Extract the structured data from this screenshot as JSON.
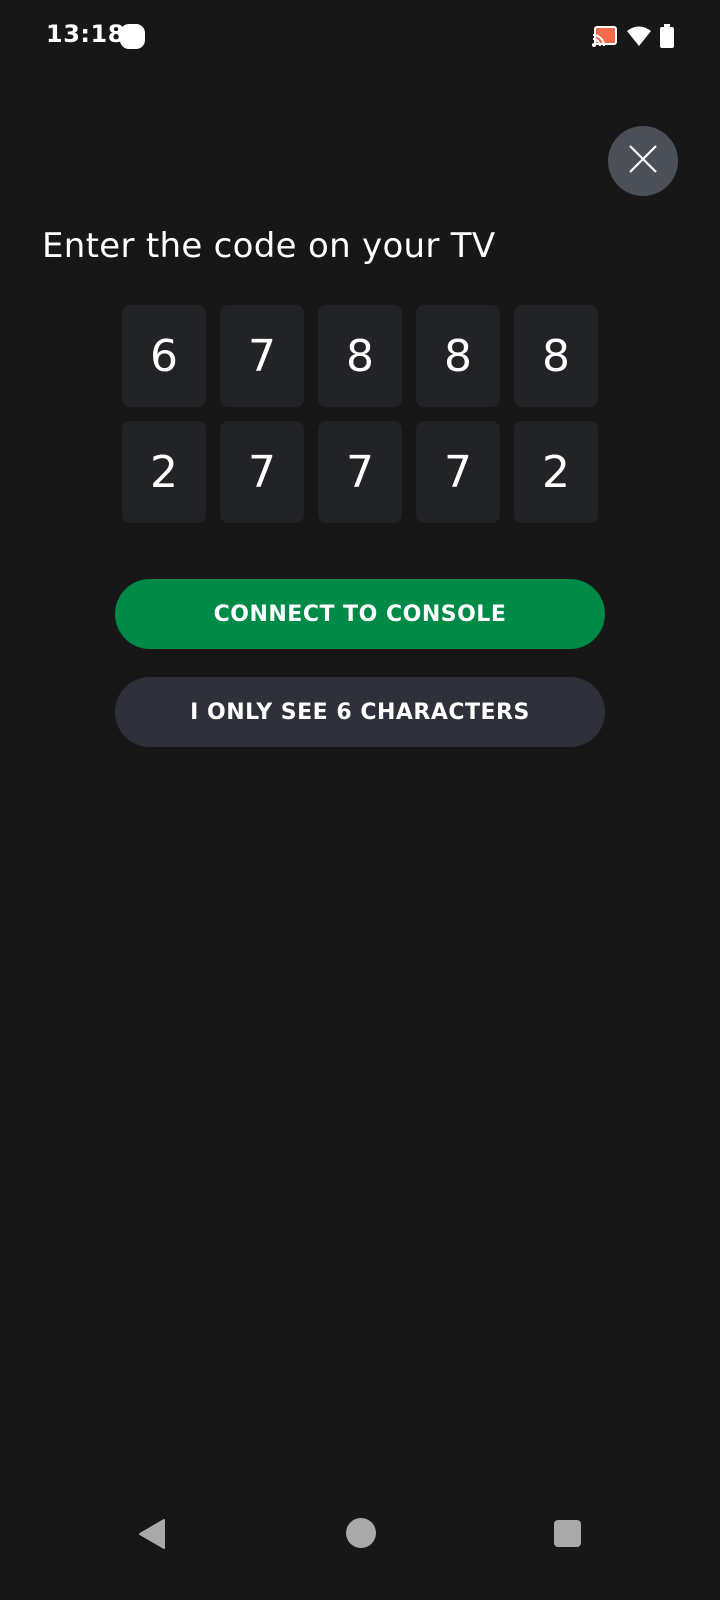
{
  "status_bar": {
    "time": "13:18",
    "icons": [
      "app-notification-icon",
      "cast-icon",
      "wifi-icon",
      "battery-icon"
    ]
  },
  "close_button": {
    "icon": "close-icon"
  },
  "prompt": {
    "title": "Enter the code on your TV"
  },
  "code": {
    "rows": [
      [
        "6",
        "7",
        "8",
        "8",
        "8"
      ],
      [
        "2",
        "7",
        "7",
        "7",
        "2"
      ]
    ]
  },
  "buttons": {
    "connect_label": "CONNECT TO CONSOLE",
    "six_chars_label": "I ONLY SEE 6 CHARACTERS"
  },
  "colors": {
    "background": "#171718",
    "code_cell": "#222327",
    "connect_button": "#008a48",
    "secondary_button": "#2e3139",
    "close_button": "#4a4f58",
    "cast_accent": "#f26b4b"
  },
  "nav_bar": {
    "icons": [
      "back-icon",
      "home-icon",
      "recents-icon"
    ]
  }
}
